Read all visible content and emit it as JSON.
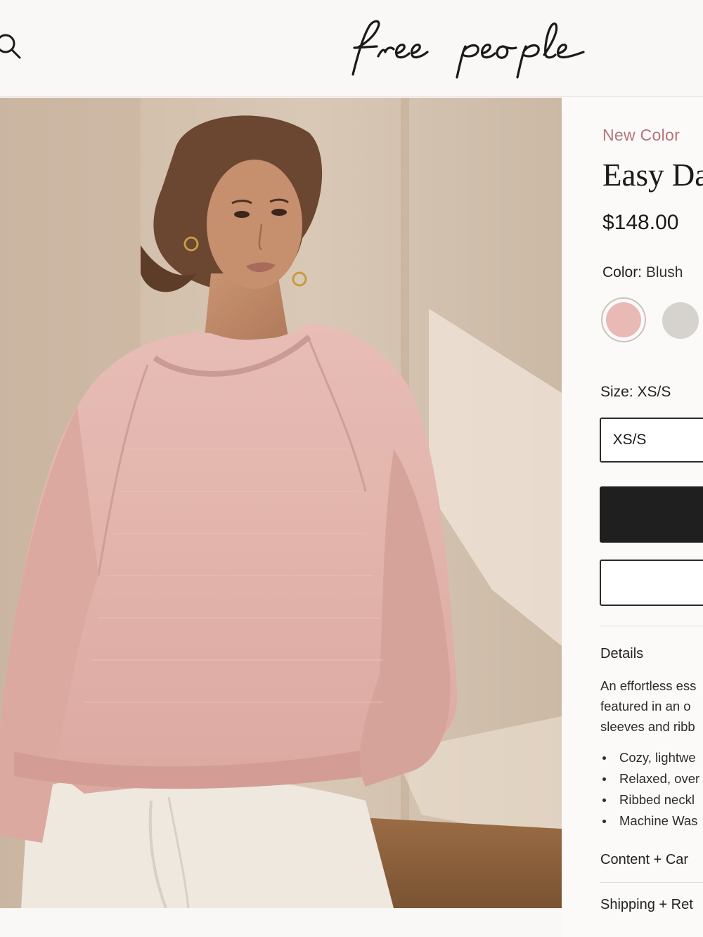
{
  "header": {
    "logo_text": "free people",
    "search_icon": "search-icon"
  },
  "product": {
    "badge": "New Color",
    "title": "Easy Da",
    "price": "$148.00",
    "color_label": "Color:",
    "color_value": "Blush",
    "swatches": [
      {
        "name": "blush",
        "color": "#e8b9b5",
        "selected": true
      },
      {
        "name": "heather-grey",
        "color": "#d6d2ce",
        "selected": false
      }
    ],
    "size_label": "Size:",
    "size_value": "XS/S",
    "size_option": "XS/S"
  },
  "details": {
    "title": "Details",
    "description": [
      "An effortless ess",
      "featured in an o",
      "sleeves and ribb"
    ],
    "bullets": [
      "Cozy, lightwe",
      "Relaxed, over",
      "Ribbed neckl",
      "Machine Was"
    ]
  },
  "accordions": {
    "content_care": "Content + Car",
    "shipping_returns": "Shipping + Ret"
  },
  "colors": {
    "accent_badge": "#b3757a",
    "primary_button": "#1f1f1f",
    "sweater_pink": "#e3b3ab"
  }
}
